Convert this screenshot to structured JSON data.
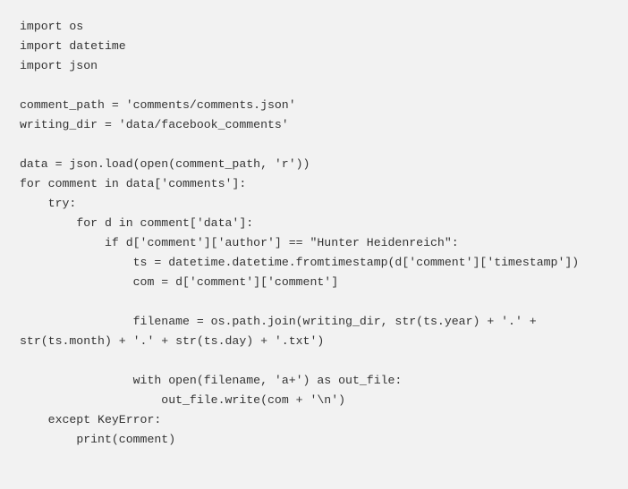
{
  "code_block": {
    "language": "python",
    "background_color": "#f2f2f2",
    "text_color": "#333333",
    "source": "import os\nimport datetime\nimport json\n\ncomment_path = 'comments/comments.json'\nwriting_dir = 'data/facebook_comments'\n\ndata = json.load(open(comment_path, 'r'))\nfor comment in data['comments']:\n    try:\n        for d in comment['data']:\n            if d['comment']['author'] == \"Hunter Heidenreich\":\n                ts = datetime.datetime.fromtimestamp(d['comment']['timestamp'])\n                com = d['comment']['comment']\n\n                filename = os.path.join(writing_dir, str(ts.year) + '.' + str(ts.month) + '.' + str(ts.day) + '.txt')\n\n                with open(filename, 'a+') as out_file:\n                    out_file.write(com + '\\n')\n    except KeyError:\n        print(comment)",
    "lines": [
      "import os",
      "import datetime",
      "import json",
      "",
      "comment_path = 'comments/comments.json'",
      "writing_dir = 'data/facebook_comments'",
      "",
      "data = json.load(open(comment_path, 'r'))",
      "for comment in data['comments']:",
      "    try:",
      "        for d in comment['data']:",
      "            if d['comment']['author'] == \"Hunter Heidenreich\":",
      "                ts = datetime.datetime.fromtimestamp(d['comment']['timestamp'])",
      "                com = d['comment']['comment']",
      "",
      "                filename = os.path.join(writing_dir, str(ts.year) + '.' + str(ts.month) + '.' + str(ts.day) + '.txt')",
      "",
      "                with open(filename, 'a+') as out_file:",
      "                    out_file.write(com + '\\n')",
      "    except KeyError:",
      "        print(comment)"
    ]
  }
}
